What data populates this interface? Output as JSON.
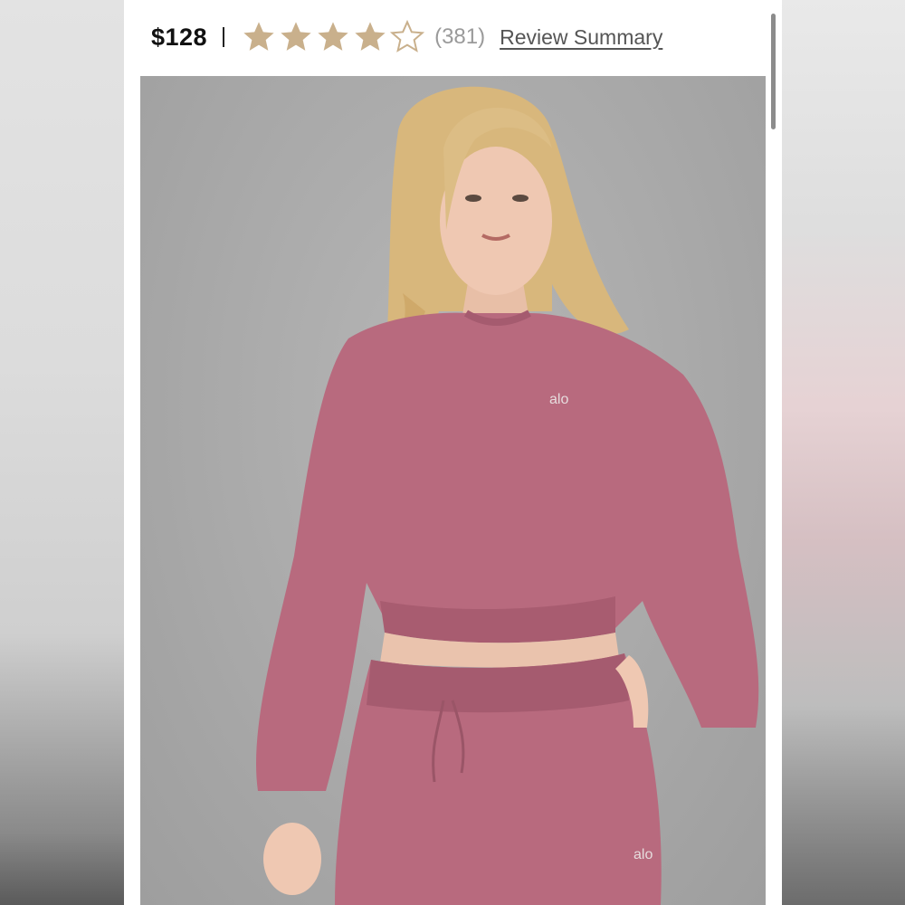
{
  "product": {
    "price": "$128",
    "rating": 4.5,
    "rating_max": 5,
    "review_count": "(381)",
    "review_link": "Review Summary",
    "image_logo_text": "alo"
  },
  "colors": {
    "star_fill": "#c9b08c",
    "garment": "#b86a7e",
    "background": "#a9a9a9"
  }
}
